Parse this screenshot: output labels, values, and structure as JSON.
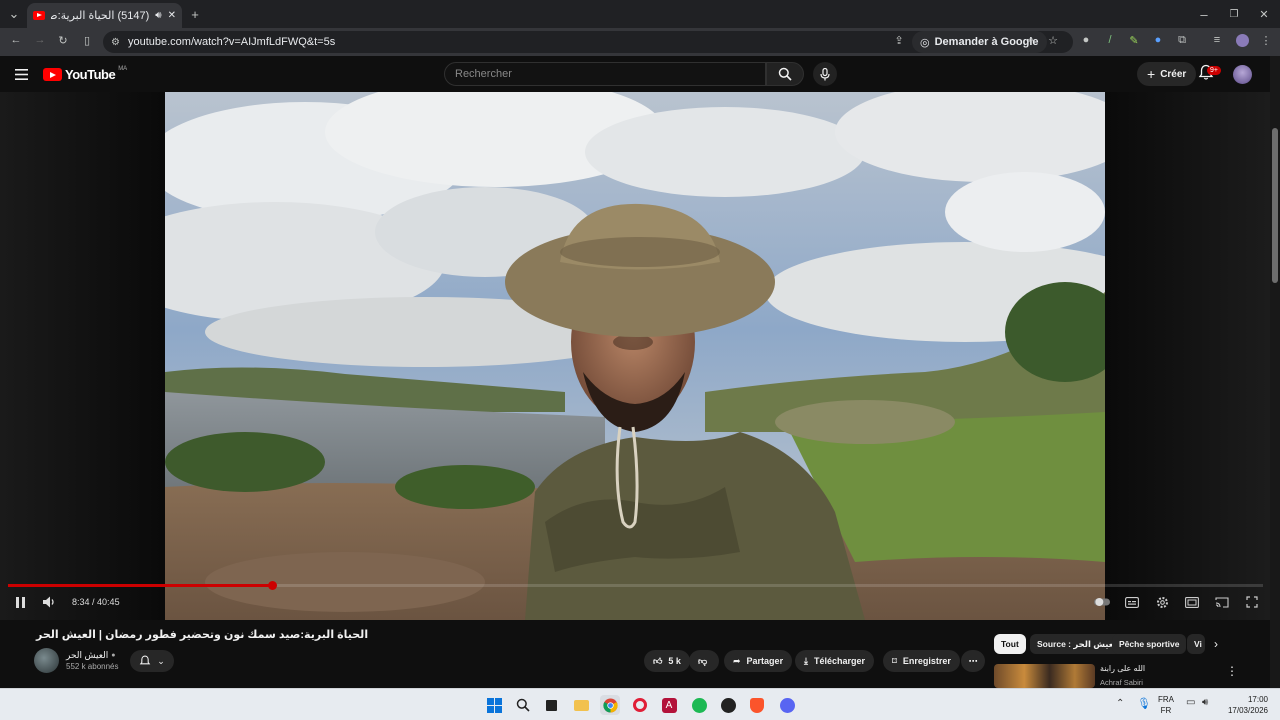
{
  "browser": {
    "tab_title": "(5147) الحياة البرية:صيد سمك",
    "tab_sound_icon": "speaker-icon",
    "new_tab_label": "+",
    "url": "youtube.com/watch?v=AIJmfLdFWQ&t=5s",
    "ask_google_label": "Demander à Google",
    "window_controls": [
      "–",
      "❐",
      "✕"
    ]
  },
  "youtube": {
    "logo_text": "YouTube",
    "country_code": "MA",
    "search_placeholder": "Rechercher",
    "create_label": "Créer",
    "notification_count": "9+"
  },
  "player": {
    "time_current": "8:34",
    "time_sep": " / ",
    "time_total": "40:45",
    "progress_fraction": 0.21
  },
  "video": {
    "title": "الحياة البرية:صيد سمك نون وتحضير فطور رمضان | العيش الحر",
    "channel_name": "العيش الحر",
    "channel_subs": "552 k abonnés",
    "likes": "5 k",
    "share_label": "Partager",
    "download_label": "Télécharger",
    "save_label": "Enregistrer"
  },
  "chips": [
    {
      "label": "Tout",
      "active": true
    },
    {
      "label": "Source : العيش الحر",
      "active": false
    },
    {
      "label": "Pêche sportive",
      "active": false
    },
    {
      "label": "Vi",
      "active": false
    }
  ],
  "recommendation": {
    "title": "الله على رابنة",
    "channel": "Achraf Sabiri"
  },
  "taskbar": {
    "lang_top": "FRA",
    "lang_bottom": "FR",
    "time": "17:00",
    "date": "17/03/2026"
  },
  "colors": {
    "youtube_red": "#ff0000",
    "progress_red": "#cc0000",
    "background": "#0f0f0f"
  }
}
